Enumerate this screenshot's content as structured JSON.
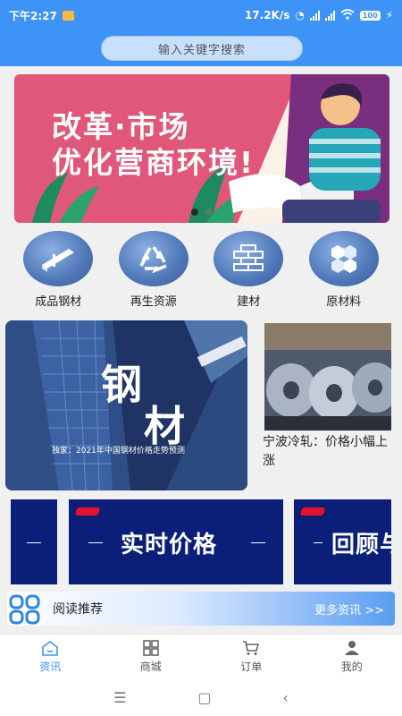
{
  "status": {
    "time": "下午2:27",
    "speed": "17.2K/s",
    "battery": "100"
  },
  "search": {
    "placeholder": "输入关键字搜索"
  },
  "banner": {
    "line1": "改革·市场",
    "line2": "优化营商环境!",
    "slides_total": 2,
    "active_slide": 1
  },
  "categories": [
    {
      "label": "成品钢材",
      "icon": "steel-beam-icon"
    },
    {
      "label": "再生资源",
      "icon": "recycle-icon"
    },
    {
      "label": "建材",
      "icon": "bricks-icon"
    },
    {
      "label": "原材料",
      "icon": "hexagon-materials-icon"
    }
  ],
  "hero": {
    "char1": "钢",
    "char2": "材",
    "caption": "独家：2021年中国钢材价格走势预测"
  },
  "news": {
    "title": "宁波冷轧：价格小幅上涨"
  },
  "promos": [
    {
      "text": "实时价格"
    },
    {
      "text": "回顾与"
    }
  ],
  "reading": {
    "label": "阅读推荐",
    "more": "更多资讯 >>"
  },
  "tabs": [
    {
      "label": "资讯",
      "icon": "home-icon",
      "active": true
    },
    {
      "label": "商城",
      "icon": "grid-icon",
      "active": false
    },
    {
      "label": "订单",
      "icon": "cart-icon",
      "active": false
    },
    {
      "label": "我的",
      "icon": "user-icon",
      "active": false
    }
  ],
  "colors": {
    "primary": "#3d94f6",
    "banner_pink": "#e0577a",
    "promo_navy": "#0b1f79",
    "promo_red": "#e8112a"
  }
}
